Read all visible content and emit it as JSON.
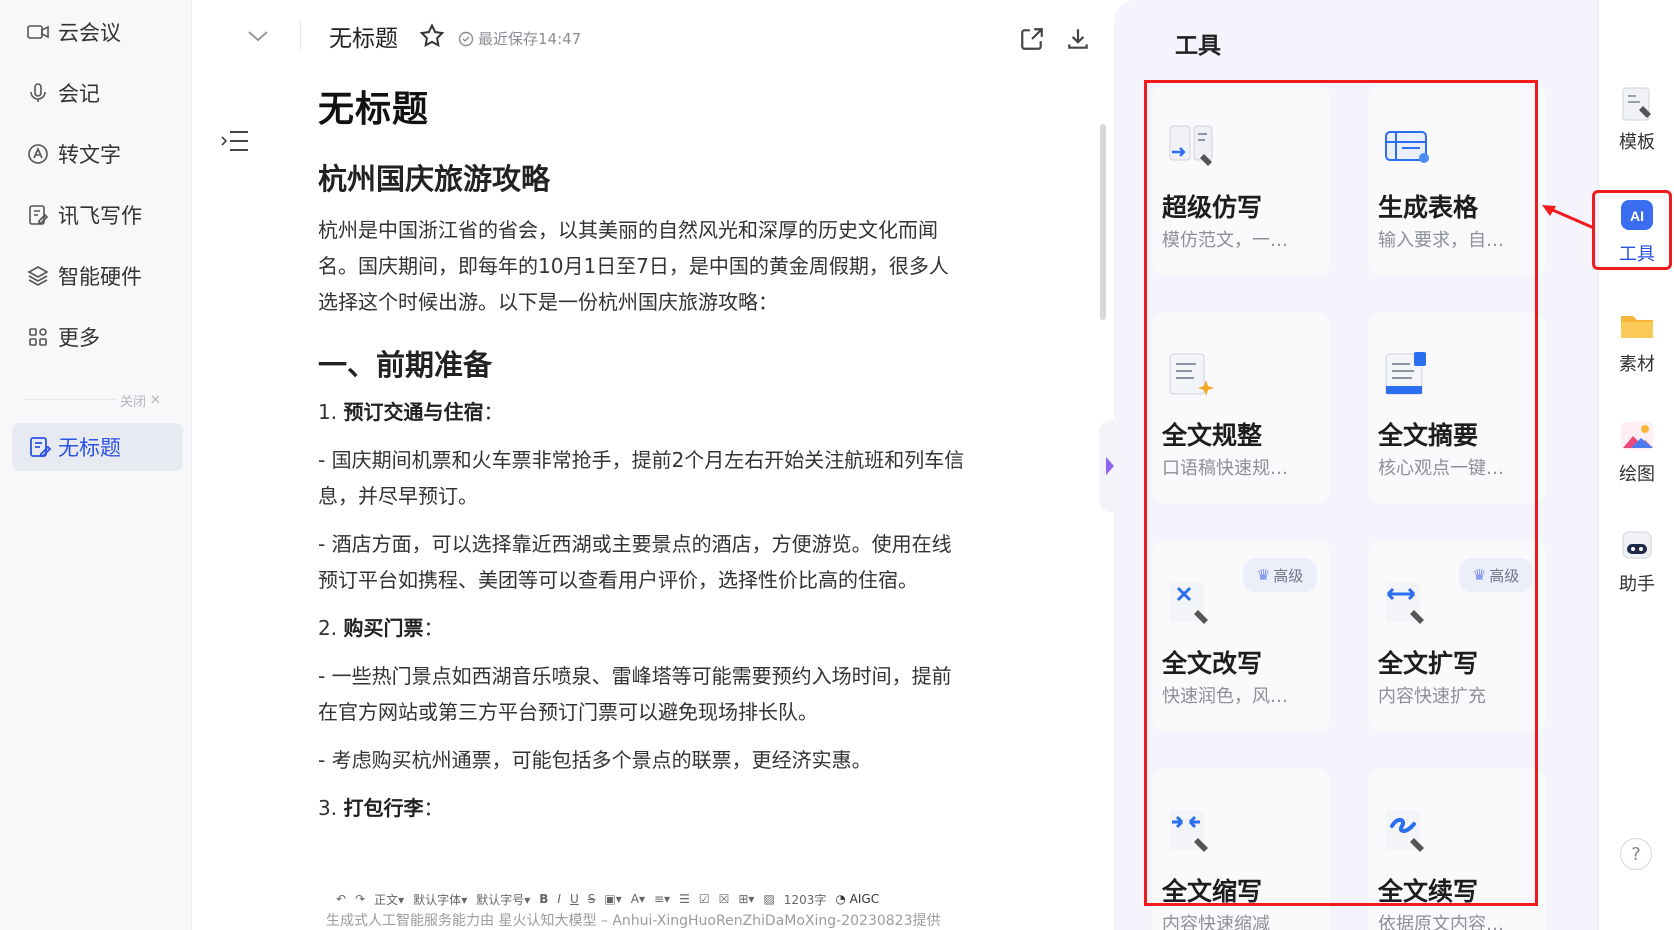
{
  "nav": {
    "items": [
      {
        "label": "云会议",
        "icon": "video-icon"
      },
      {
        "label": "会记",
        "icon": "microphone-icon"
      },
      {
        "label": "转文字",
        "icon": "text-convert-icon"
      },
      {
        "label": "讯飞写作",
        "icon": "edit-doc-icon"
      },
      {
        "label": "智能硬件",
        "icon": "layers-icon"
      },
      {
        "label": "更多",
        "icon": "grid-icon"
      }
    ],
    "close_label": "关闭",
    "open_doc_label": "无标题"
  },
  "header": {
    "title": "无标题",
    "save_status": "最近保存14:47"
  },
  "doc": {
    "title": "无标题",
    "heading": "杭州国庆旅游攻略",
    "intro": "杭州是中国浙江省的省会，以其美丽的自然风光和深厚的历史文化而闻名。国庆期间，即每年的10月1日至7日，是中国的黄金周假期，很多人选择这个时候出游。以下是一份杭州国庆旅游攻略：",
    "section1": "一、前期准备",
    "item1_num": "1. ",
    "item1_title": "预订交通与住宿",
    "item1_colon": "：",
    "item1_sub1": "- 国庆期间机票和火车票非常抢手，提前2个月左右开始关注航班和列车信息，并尽早预订。",
    "item1_sub2": "- 酒店方面，可以选择靠近西湖或主要景点的酒店，方便游览。使用在线预订平台如携程、美团等可以查看用户评价，选择性价比高的住宿。",
    "item2_num": "2. ",
    "item2_title": "购买门票",
    "item2_colon": "：",
    "item2_sub1": "- 一些热门景点如西湖音乐喷泉、雷峰塔等可能需要预约入场时间，提前在官方网站或第三方平台预订门票可以避免现场排长队。",
    "item2_sub2": "- 考虑购买杭州通票，可能包括多个景点的联票，更经济实惠。",
    "item3_num": "3. ",
    "item3_title": "打包行李",
    "item3_colon": "："
  },
  "toolbar": {
    "undo": "↶",
    "redo": "↷",
    "style": "正文",
    "font": "默认字体",
    "size": "默认字号",
    "bold": "B",
    "italic": "I",
    "underline": "U",
    "strike": "S",
    "word_count": "1203字",
    "aigc": "AIGC"
  },
  "footer": "生成式人工智能服务能力由 星火认知大模型 – Anhui-XingHuoRenZhiDaMoXing-20230823提供",
  "panel": {
    "title": "工具",
    "cards": [
      {
        "title": "超级仿写",
        "desc": "模仿范文，一…",
        "badge": ""
      },
      {
        "title": "生成表格",
        "desc": "输入要求，自…",
        "badge": ""
      },
      {
        "title": "全文规整",
        "desc": "口语稿快速规…",
        "badge": ""
      },
      {
        "title": "全文摘要",
        "desc": "核心观点一键…",
        "badge": ""
      },
      {
        "title": "全文改写",
        "desc": "快速润色，风…",
        "badge": "高级"
      },
      {
        "title": "全文扩写",
        "desc": "内容快速扩充",
        "badge": "高级"
      },
      {
        "title": "全文缩写",
        "desc": "内容快速缩减",
        "badge": ""
      },
      {
        "title": "全文续写",
        "desc": "依据原文内容…",
        "badge": ""
      }
    ]
  },
  "rail": {
    "items": [
      {
        "label": "模板",
        "icon": "template-icon"
      },
      {
        "label": "工具",
        "icon": "ai-tools-icon",
        "active": true
      },
      {
        "label": "素材",
        "icon": "folder-icon"
      },
      {
        "label": "绘图",
        "icon": "image-icon"
      },
      {
        "label": "助手",
        "icon": "robot-icon"
      }
    ],
    "help": "?"
  },
  "colors": {
    "accent": "#2b52e0",
    "highlight_box": "#f01c1c",
    "panel_bg": "#f5f3fb"
  }
}
